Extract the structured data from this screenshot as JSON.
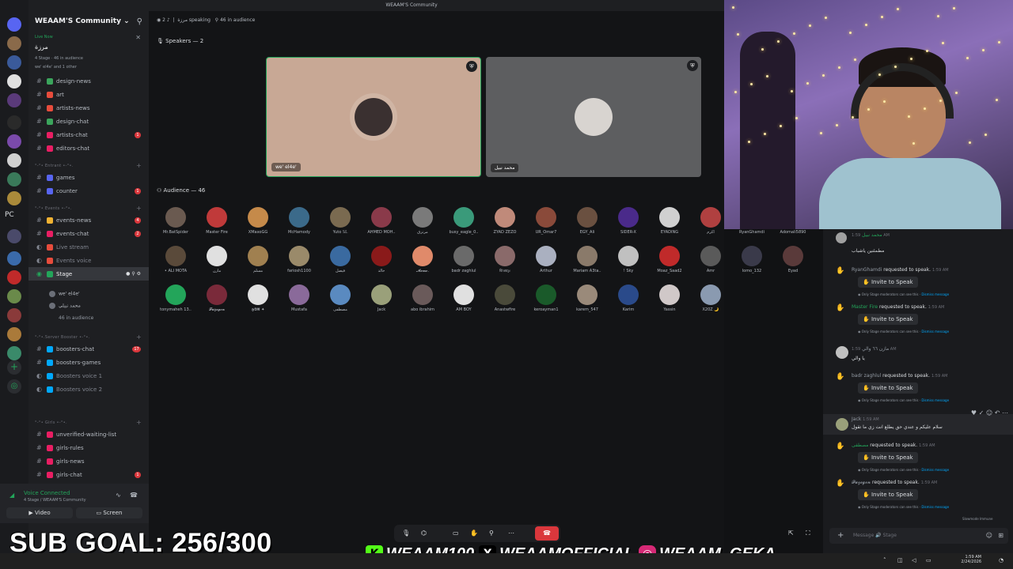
{
  "window": {
    "title": "WEAAM'S Community"
  },
  "server": {
    "name": "WEAAM'S Community"
  },
  "rail": {
    "badges": [
      "1k+",
      "PC",
      "404",
      "2k+"
    ]
  },
  "stage_banner": {
    "live": "Live Now",
    "title": "مرزة",
    "meta": "4 Stage · 46 in audience",
    "speakers_preview": "we' el4e' and 1 other"
  },
  "channels": [
    {
      "name": "design-news",
      "color": "#3ba55c"
    },
    {
      "name": "art",
      "color": "#e74c3c"
    },
    {
      "name": "artists-news",
      "color": "#e74c3c"
    },
    {
      "name": "design-chat",
      "color": "#3ba55c"
    },
    {
      "name": "artists-chat",
      "color": "#e91e63",
      "badge": "1"
    },
    {
      "name": "editors-chat",
      "color": "#e91e63"
    }
  ],
  "categories": {
    "entrant": "°-°• Entrant •-°•.",
    "events": "°-°• Events •-°•.",
    "boosters": "°-°•.Server Booster •-°•.",
    "girls": "°-°• Girls •-°•."
  },
  "channels_entrant": [
    {
      "name": "games",
      "color": "#5865f2"
    },
    {
      "name": "counter",
      "color": "#5865f2",
      "badge": "1"
    }
  ],
  "channels_events": [
    {
      "name": "events-news",
      "color": "#f0b232",
      "badge": "4"
    },
    {
      "name": "events-chat",
      "color": "#e91e63",
      "badge": "2"
    },
    {
      "name": "Live stream",
      "color": "#e74c3c"
    },
    {
      "name": "Events voice",
      "color": "#e74c3c"
    },
    {
      "name": "Stage",
      "color": "#23a55a",
      "active": true
    }
  ],
  "stage_users": [
    {
      "name": "we' el4e'"
    },
    {
      "name": "محمد نبيلي"
    },
    {
      "name": "46 in audience"
    }
  ],
  "channels_boosters": [
    {
      "name": "boosters-chat",
      "color": "#00a8fc",
      "badge": "17"
    },
    {
      "name": "boosters-games",
      "color": "#00a8fc"
    },
    {
      "name": "Boosters voice 1",
      "color": "#00a8fc"
    },
    {
      "name": "Boosters voice 2",
      "color": "#00a8fc"
    }
  ],
  "channels_girls": [
    {
      "name": "unverified-waiting-list",
      "color": "#e91e63"
    },
    {
      "name": "girls-rules",
      "color": "#e91e63"
    },
    {
      "name": "girls-news",
      "color": "#e91e63"
    },
    {
      "name": "girls-chat",
      "color": "#e91e63",
      "badge": "1"
    }
  ],
  "voice": {
    "status": "Voice Connected",
    "sub": "4 Stage / WEAAM'S Community",
    "video_label": "Video",
    "screen_label": "Screen"
  },
  "stage_header": {
    "title": "مرزة",
    "speaking": "2 speaking",
    "audience": "46 in audience"
  },
  "speakers": {
    "label": "Speakers — 2",
    "tiles": [
      {
        "name": "we' el4e'",
        "bg": "#c8a895",
        "av": "#3a3030"
      },
      {
        "name": "محمد نبيل",
        "bg": "#5d5e60",
        "av": "#d8d4d0"
      }
    ]
  },
  "audience": {
    "label": "Audience — 46",
    "members": [
      {
        "name": "Mr.BatSpider",
        "c": "#6a5a50"
      },
      {
        "name": "Master Fire",
        "c": "#c03a3a"
      },
      {
        "name": "XMaxoGG",
        "c": "#c58a4a"
      },
      {
        "name": "McHamody",
        "c": "#3b6a8a"
      },
      {
        "name": "Yuto 𝕊𝕃",
        "c": "#7a6a50"
      },
      {
        "name": "AHMED MOH..",
        "c": "#8a3a4a"
      },
      {
        "name": "مرتزق",
        "c": "#7a7a7a"
      },
      {
        "name": "busy_eagle_0..",
        "c": "#3a9a7a"
      },
      {
        "name": "ZYAD ZEZO",
        "c": "#c08a7a"
      },
      {
        "name": "UR_Omar7",
        "c": "#8a4a3a"
      },
      {
        "name": "EGY_Ali",
        "c": "#6a5040"
      },
      {
        "name": "SIDER-X",
        "c": "#4a2a8a"
      },
      {
        "name": "EYADING",
        "c": "#d0d0d0"
      },
      {
        "name": "اكرم",
        "c": "#b04040"
      },
      {
        "name": "RyanGhamdi",
        "c": "#1a1b1e"
      },
      {
        "name": "Adomali5890",
        "c": "#1a1b1e"
      },
      {
        "name": "• ALI MOTA",
        "c": "#5a4a3a"
      },
      {
        "name": "مازن",
        "c": "#e0e0e0"
      },
      {
        "name": "مسلم",
        "c": "#a08050"
      },
      {
        "name": "fariosh1100",
        "c": "#9a8a6a"
      },
      {
        "name": "فيصل",
        "c": "#3a6aa0"
      },
      {
        "name": "خالد",
        "c": "#8a1a1a"
      },
      {
        "name": "𝓜𝓮𝓶𝓸.",
        "c": "#e08a6a"
      },
      {
        "name": "badr zaghlul",
        "c": "#6a6a6a"
      },
      {
        "name": "𝔎𝔦𝔪𝔞𝔷𝔢",
        "c": "#8a6a6a"
      },
      {
        "name": "Arthur",
        "c": "#aab0c0"
      },
      {
        "name": "Mariam A3ta..",
        "c": "#8a7a6a"
      },
      {
        "name": "! Sky",
        "c": "#c0c0c0"
      },
      {
        "name": "Moaz_Saad2",
        "c": "#c02a2a"
      },
      {
        "name": "Amr",
        "c": "#5a5a5a"
      },
      {
        "name": "lomo_132",
        "c": "#3a3a4a"
      },
      {
        "name": "Eyad",
        "c": "#5a3a3a"
      },
      {
        "name": "tonymaheh 13..",
        "c": "#23a55a"
      },
      {
        "name": "𝓕𝓾𝔃𝓮𝓰𝓸𝓷",
        "c": "#7a2a3a"
      },
      {
        "name": "𝕳𝕭𝕽 ✦",
        "c": "#e0e0e0"
      },
      {
        "name": "Mustafa",
        "c": "#8a6a9a"
      },
      {
        "name": "مصطفى",
        "c": "#5a8ac0"
      },
      {
        "name": "Jack",
        "c": "#9aa07a"
      },
      {
        "name": "abo ibrahim",
        "c": "#6a5a5a"
      },
      {
        "name": "AM BOY",
        "c": "#e0e0e0"
      },
      {
        "name": "Anastwfire",
        "c": "#4a4a3a"
      },
      {
        "name": "keroayman1",
        "c": "#1a5a2a"
      },
      {
        "name": "karem_547",
        "c": "#9a8a7a"
      },
      {
        "name": "Karim",
        "c": "#2a4a8a"
      },
      {
        "name": "Yassin",
        "c": "#d0c8c8"
      },
      {
        "name": "X20Z 🌙",
        "c": "#8a9ab0"
      }
    ]
  },
  "chat": {
    "messages": [
      {
        "type": "text",
        "user": "محمد نبيل",
        "time": "1:59 AM",
        "text": "مطمئنين ياشباب"
      },
      {
        "type": "request",
        "user": "RyanGhamdi",
        "action": "requested to speak.",
        "time": "1:59 AM"
      },
      {
        "type": "request",
        "user": "Master Fire",
        "action": "requested to speak.",
        "time": "1:59 AM"
      },
      {
        "type": "text",
        "user": "مازن ٦٦ والي",
        "time": "1:59 AM",
        "text": "يا والي"
      },
      {
        "type": "request",
        "user": "badr zaghlul",
        "action": "requested to speak.",
        "time": "1:59 AM"
      },
      {
        "type": "text",
        "user": "Jack",
        "time": "1:59 AM",
        "text": "سلام عليكم و عندي حق يطلع انت زي ما تقول"
      },
      {
        "type": "request",
        "user": "مصطفى",
        "action": "requested to speak.",
        "time": "1:59 AM"
      },
      {
        "type": "request",
        "user": "𝓕𝓾𝔃𝓮𝓰𝓸𝓷",
        "action": "requested to speak.",
        "time": "1:59 AM"
      }
    ],
    "invite_label": "Invite to Speak",
    "note": "Only Stage moderators can see this",
    "dismiss": "Dismiss message",
    "slowmode": "Slowmode Immune",
    "input_placeholder": "Message 🔊 Stage"
  },
  "overlay": {
    "subgoal": "SUB GOAL: 256/300",
    "kick": "WEAAM100",
    "x": "WEAAMOFFICIAL",
    "instagram": "WEAAM_GEKA"
  },
  "taskbar": {
    "time": "1:59 AM",
    "date": "2/24/2026"
  }
}
